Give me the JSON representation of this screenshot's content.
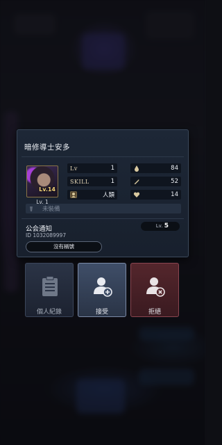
{
  "player": {
    "name": "暗修導士安多",
    "portrait": {
      "level_badge": "Lv.14",
      "level_label": "Lv. 1"
    },
    "stats": {
      "lv_label": "Lv",
      "lv_value": "1",
      "skill_label": "SKILL",
      "skill_value": "1",
      "race_value": "人類",
      "stat1_value": "84",
      "stat2_value": "52",
      "stat3_value": "14"
    },
    "equipment_placeholder": "未裝備"
  },
  "guild": {
    "label": "公会通知",
    "id": "ID 1032089997",
    "level_prefix": "Lv.",
    "level_value": "5",
    "title_button": "沒有稱號"
  },
  "actions": {
    "record_label": "個人紀錄",
    "accept_label": "接受",
    "reject_label": "拒絕"
  },
  "icons": {
    "stat1": "drop-icon",
    "stat2": "feather-icon",
    "stat3": "heart-icon",
    "race": "race-icon",
    "equipment": "equipment-icon",
    "record": "document-icon",
    "accept": "user-add-icon",
    "reject": "user-remove-icon"
  },
  "colors": {
    "panel_bg": "#1d2736",
    "accept_bg": "#3f4e68",
    "reject_bg": "#54262c",
    "gold": "#e8d9b8"
  }
}
